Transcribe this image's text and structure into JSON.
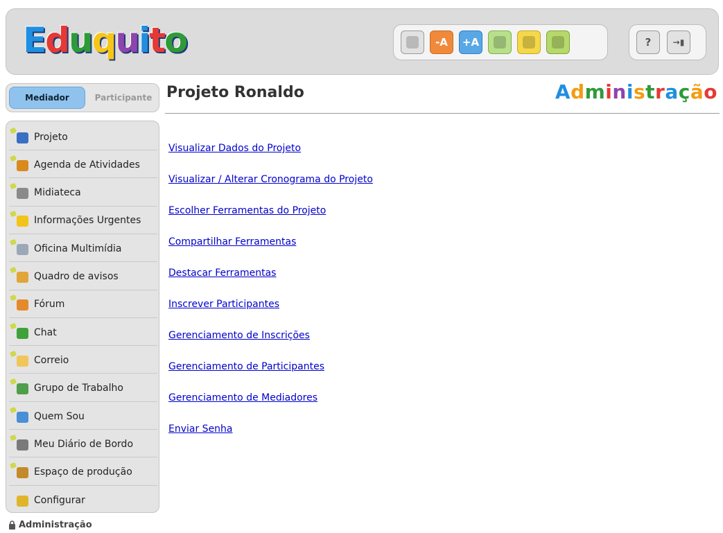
{
  "header": {
    "logo": "Eduquito",
    "toolbar": [
      {
        "name": "acessibilidade-icon",
        "label": "",
        "style": "gray"
      },
      {
        "name": "decrease-font-icon",
        "label": "-A",
        "style": "orange"
      },
      {
        "name": "increase-font-icon",
        "label": "+A",
        "style": "blue"
      },
      {
        "name": "libras-icon",
        "label": "",
        "style": "green"
      },
      {
        "name": "audio-icon",
        "label": "",
        "style": "yellow"
      },
      {
        "name": "tree-icon",
        "label": "",
        "style": "lime"
      }
    ],
    "help_label": "?",
    "exit_label": "→▮"
  },
  "mode": {
    "mediador": "Mediador",
    "participante": "Participante"
  },
  "sidebar": {
    "items": [
      {
        "label": "Projeto",
        "icon": "ruler-icon",
        "color": "#3b6fc2"
      },
      {
        "label": "Agenda de Atividades",
        "icon": "calendar-icon",
        "color": "#d98a1e"
      },
      {
        "label": "Midiateca",
        "icon": "camera-icon",
        "color": "#8a8a8a"
      },
      {
        "label": "Informações Urgentes",
        "icon": "warning-icon",
        "color": "#f2c419"
      },
      {
        "label": "Oficina Multimídia",
        "icon": "window-icon",
        "color": "#9ca8b8"
      },
      {
        "label": "Quadro de avisos",
        "icon": "board-icon",
        "color": "#e1a53a"
      },
      {
        "label": "Fórum",
        "icon": "people-icon",
        "color": "#e48a2a"
      },
      {
        "label": "Chat",
        "icon": "chat-icon",
        "color": "#3fa13a"
      },
      {
        "label": "Correio",
        "icon": "mail-icon",
        "color": "#f0c65a"
      },
      {
        "label": "Grupo de Trabalho",
        "icon": "group-icon",
        "color": "#4e9e4a"
      },
      {
        "label": "Quem Sou",
        "icon": "person-icon",
        "color": "#4a8fd6"
      },
      {
        "label": "Meu Diário de Bordo",
        "icon": "diary-icon",
        "color": "#7a7a7a"
      },
      {
        "label": "Espaço de produção",
        "icon": "hammer-icon",
        "color": "#c48a2a"
      },
      {
        "label": "Configurar",
        "icon": "gear-icon",
        "color": "#e0b52a"
      }
    ]
  },
  "admin_footer": "Administração",
  "main": {
    "title": "Projeto Ronaldo",
    "section_title": "Administração",
    "links": [
      "Visualizar Dados do Projeto",
      "Visualizar / Alterar Cronograma do Projeto",
      "Escolher Ferramentas do Projeto",
      "Compartilhar Ferramentas",
      "Destacar Ferramentas",
      "Inscrever Participantes",
      "Gerenciamento de Inscrições",
      "Gerenciamento de Participantes",
      "Gerenciamento de Mediadores",
      "Enviar Senha"
    ]
  },
  "colors": {
    "logo": [
      "#1f8fe0",
      "#e53935",
      "#2f9a3a",
      "#f5c518",
      "#8e44ad",
      "#1f8fe0",
      "#e53935",
      "#2f9a3a"
    ],
    "section_title": [
      "#1f8fe0",
      "#f39c12",
      "#2f9a3a",
      "#e53935",
      "#8e44ad",
      "#1f8fe0",
      "#f39c12",
      "#2f9a3a",
      "#e53935",
      "#1f8fe0",
      "#2f9a3a",
      "#f39c12",
      "#e53935"
    ]
  }
}
